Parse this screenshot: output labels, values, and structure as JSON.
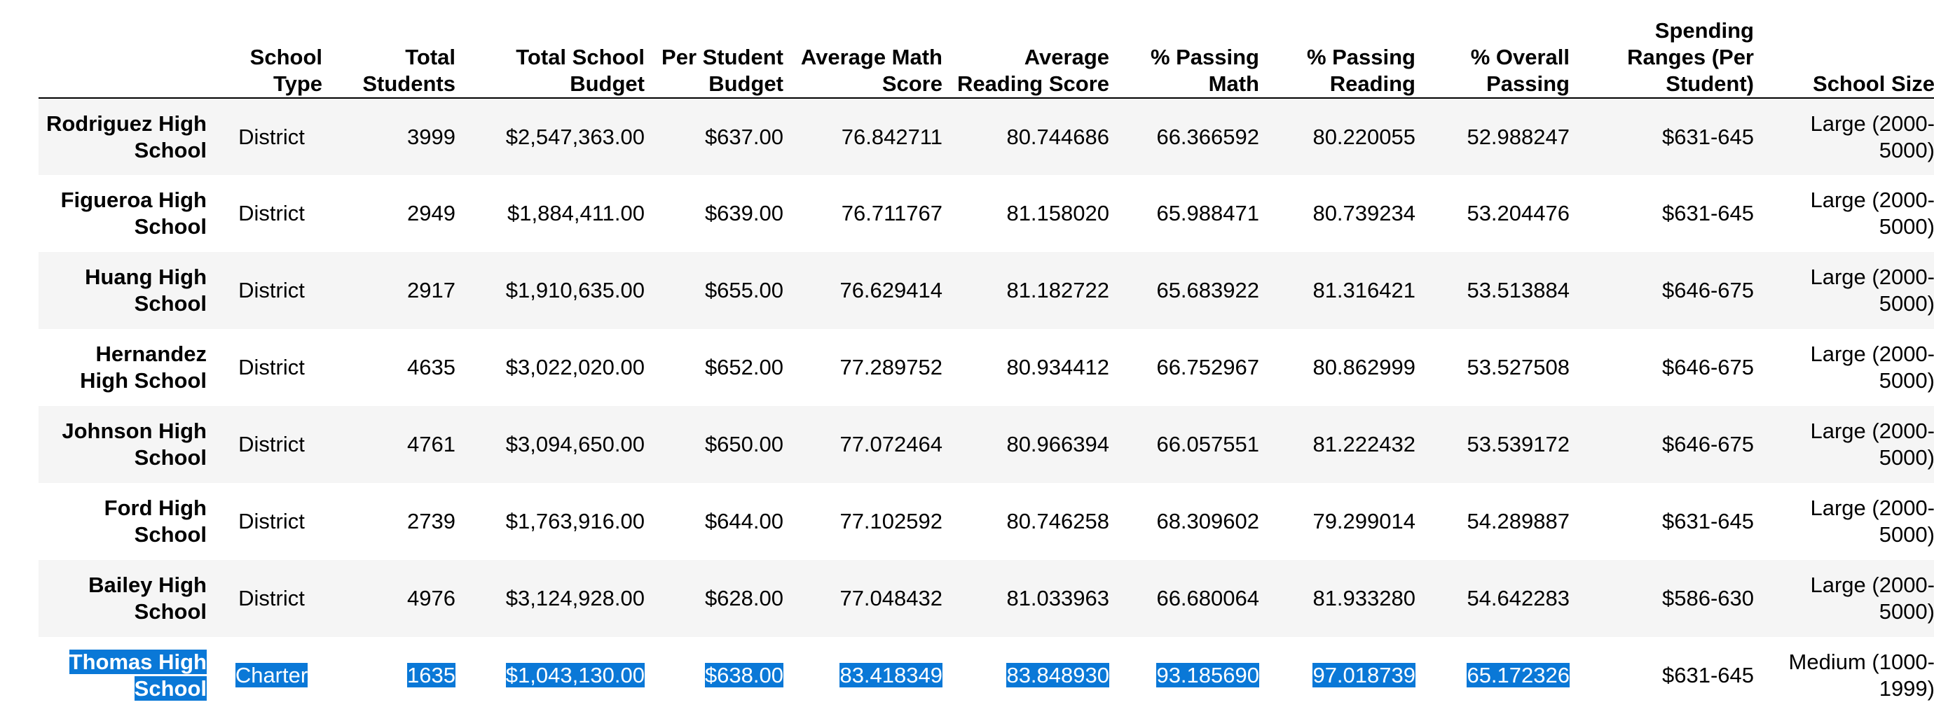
{
  "table": {
    "columns": [
      "",
      "School Type",
      "Total Students",
      "Total School Budget",
      "Per Student Budget",
      "Average Math Score",
      "Average Reading Score",
      "% Passing Math",
      "% Passing Reading",
      "% Overall Passing",
      "Spending Ranges (Per Student)",
      "School Size"
    ],
    "rows": [
      {
        "school": "Rodriguez High School",
        "type": "District",
        "students": "3999",
        "budget": "$2,547,363.00",
        "per_student": "$637.00",
        "math": "76.842711",
        "reading": "80.744686",
        "pass_math": "66.366592",
        "pass_reading": "80.220055",
        "overall": "52.988247",
        "spending_range": "$631-645",
        "size": "Large (2000-5000)"
      },
      {
        "school": "Figueroa High School",
        "type": "District",
        "students": "2949",
        "budget": "$1,884,411.00",
        "per_student": "$639.00",
        "math": "76.711767",
        "reading": "81.158020",
        "pass_math": "65.988471",
        "pass_reading": "80.739234",
        "overall": "53.204476",
        "spending_range": "$631-645",
        "size": "Large (2000-5000)"
      },
      {
        "school": "Huang High School",
        "type": "District",
        "students": "2917",
        "budget": "$1,910,635.00",
        "per_student": "$655.00",
        "math": "76.629414",
        "reading": "81.182722",
        "pass_math": "65.683922",
        "pass_reading": "81.316421",
        "overall": "53.513884",
        "spending_range": "$646-675",
        "size": "Large (2000-5000)"
      },
      {
        "school": "Hernandez High School",
        "type": "District",
        "students": "4635",
        "budget": "$3,022,020.00",
        "per_student": "$652.00",
        "math": "77.289752",
        "reading": "80.934412",
        "pass_math": "66.752967",
        "pass_reading": "80.862999",
        "overall": "53.527508",
        "spending_range": "$646-675",
        "size": "Large (2000-5000)"
      },
      {
        "school": "Johnson High School",
        "type": "District",
        "students": "4761",
        "budget": "$3,094,650.00",
        "per_student": "$650.00",
        "math": "77.072464",
        "reading": "80.966394",
        "pass_math": "66.057551",
        "pass_reading": "81.222432",
        "overall": "53.539172",
        "spending_range": "$646-675",
        "size": "Large (2000-5000)"
      },
      {
        "school": "Ford High School",
        "type": "District",
        "students": "2739",
        "budget": "$1,763,916.00",
        "per_student": "$644.00",
        "math": "77.102592",
        "reading": "80.746258",
        "pass_math": "68.309602",
        "pass_reading": "79.299014",
        "overall": "54.289887",
        "spending_range": "$631-645",
        "size": "Large (2000-5000)"
      },
      {
        "school": "Bailey High School",
        "type": "District",
        "students": "4976",
        "budget": "$3,124,928.00",
        "per_student": "$628.00",
        "math": "77.048432",
        "reading": "81.033963",
        "pass_math": "66.680064",
        "pass_reading": "81.933280",
        "overall": "54.642283",
        "spending_range": "$586-630",
        "size": "Large (2000-5000)"
      },
      {
        "school": "Thomas High School",
        "type": "Charter",
        "students": "1635",
        "budget": "$1,043,130.00",
        "per_student": "$638.00",
        "math": "83.418349",
        "reading": "83.848930",
        "pass_math": "93.185690",
        "pass_reading": "97.018739",
        "overall": "65.172326",
        "spending_range": "$631-645",
        "size": "Medium (1000-1999)"
      }
    ]
  },
  "selection": {
    "row_index": 7,
    "color": "#0a78d7",
    "text_color": "#ffffff"
  }
}
